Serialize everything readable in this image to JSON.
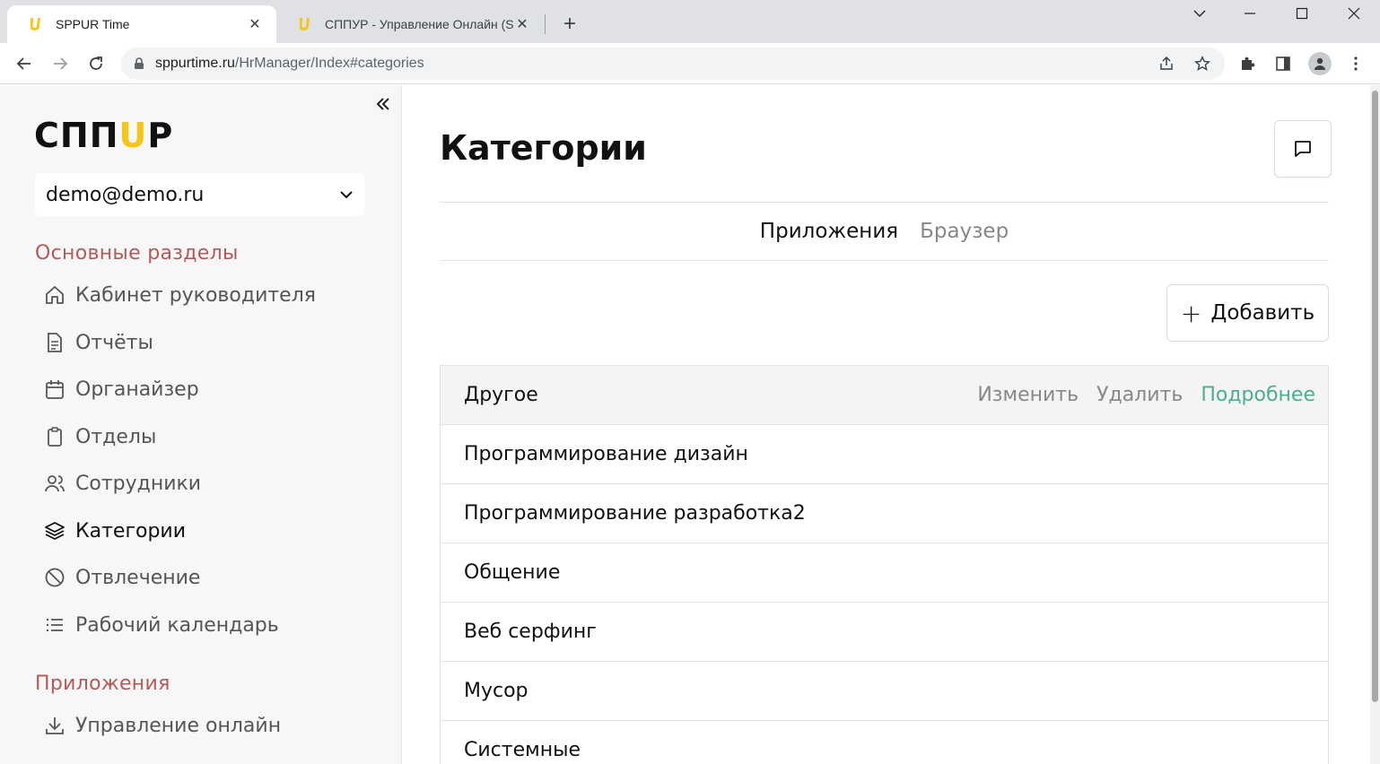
{
  "browser": {
    "tabs": [
      {
        "title": "SPPUR Time",
        "active": true
      },
      {
        "title": "СППУР - Управление Онлайн (S",
        "active": false
      }
    ],
    "url_host": "sppurtime.ru",
    "url_path": "/HrManager/Index#categories"
  },
  "sidebar": {
    "logo_left": "СПП",
    "logo_u": "U",
    "logo_right": "Р",
    "account": "demo@demo.ru",
    "section_main": "Основные разделы",
    "items": [
      {
        "label": "Кабинет руководителя",
        "icon": "home-icon"
      },
      {
        "label": "Отчёты",
        "icon": "report-icon"
      },
      {
        "label": "Органайзер",
        "icon": "calendar-icon"
      },
      {
        "label": "Отделы",
        "icon": "clipboard-icon"
      },
      {
        "label": "Сотрудники",
        "icon": "users-icon"
      },
      {
        "label": "Категории",
        "icon": "layers-icon",
        "active": true
      },
      {
        "label": "Отвлечение",
        "icon": "ban-icon"
      },
      {
        "label": "Рабочий календарь",
        "icon": "list-icon"
      }
    ],
    "section_apps": "Приложения",
    "apps_items": [
      {
        "label": "Управление онлайн",
        "icon": "download-icon"
      }
    ]
  },
  "main": {
    "title": "Категории",
    "tabs": [
      {
        "label": "Приложения",
        "active": true
      },
      {
        "label": "Браузер",
        "active": false
      }
    ],
    "add_label": "Добавить",
    "row_actions": {
      "edit": "Изменить",
      "delete": "Удалить",
      "more": "Подробнее"
    },
    "categories": [
      "Другое",
      "Программирование дизайн",
      "Программирование разработка2",
      "Общение",
      "Веб серфинг",
      "Мусор",
      "Системные"
    ]
  },
  "colors": {
    "accent_green": "#4caf8a",
    "section_red": "#b25a5a",
    "logo_yellow": "#f5c518"
  }
}
